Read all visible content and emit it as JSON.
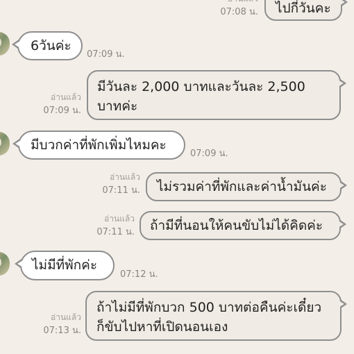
{
  "messages": [
    {
      "id": "m1",
      "side": "out",
      "text": "ไปกี่วันคะ",
      "read": "อ่านแล้ว",
      "time": "07:08 น."
    },
    {
      "id": "m2",
      "side": "in",
      "text": "6วันค่ะ",
      "time": "07:09 น."
    },
    {
      "id": "m3",
      "side": "out",
      "lines": [
        "มีวันละ 2,000 บาทและวันละ 2,500",
        "บาทค่ะ"
      ],
      "read": "อ่านแล้ว",
      "time": "07:09 น."
    },
    {
      "id": "m4",
      "side": "in",
      "text": "มีบวกค่าที่พักเพิ่มไหมคะ",
      "time": "07:09 น."
    },
    {
      "id": "m5",
      "side": "out",
      "text": "ไม่รวมค่าที่พักและค่าน้ำมันค่ะ",
      "read": "อ่านแล้ว",
      "time": "07:11 น."
    },
    {
      "id": "m6",
      "side": "out",
      "text": "ถ้ามีที่นอนให้คนขับไม่ได้คิดค่ะ",
      "read": "อ่านแล้ว",
      "time": "07:11 น."
    },
    {
      "id": "m7",
      "side": "in",
      "text": "ไม่มีที่พักค่ะ",
      "time": "07:12 น."
    },
    {
      "id": "m8",
      "side": "out",
      "lines": [
        "ถ้าไม่มีที่พักบวก 500 บาทต่อคืนค่ะเดี๋ยว",
        "ก็ขับไปหาที่เปิดนอนเอง"
      ],
      "read": "อ่านแล้ว",
      "time": "07:13 น."
    }
  ]
}
